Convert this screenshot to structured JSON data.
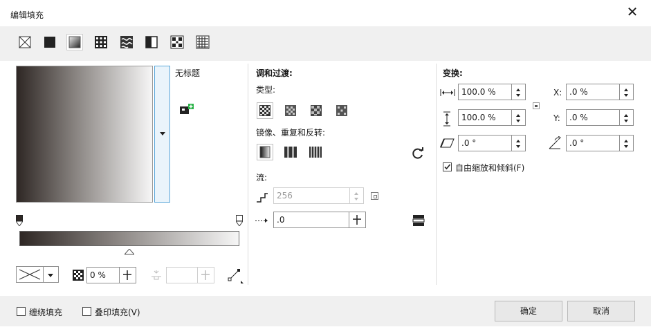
{
  "window": {
    "title": "编辑填充"
  },
  "fill_types": [
    "no-fill",
    "uniform-fill",
    "fountain-fill",
    "vector-pattern-fill",
    "bitmap-pattern-fill",
    "two-color-pattern-fill",
    "texture-fill",
    "postscript-fill"
  ],
  "preview": {
    "name": "无标题"
  },
  "blend": {
    "heading": "调和过渡:",
    "type_label": "类型:",
    "mirror_label": "镜像、重复和反转:",
    "flow_label": "流:",
    "steps_value": "256",
    "acceleration_value": ".0"
  },
  "transform": {
    "heading": "变换:",
    "width_value": "100.0 %",
    "height_value": "100.0 %",
    "x_label": "X:",
    "x_value": ".0 %",
    "y_label": "Y:",
    "y_value": ".0 %",
    "skew_value": ".0 °",
    "rotate_value": ".0 °",
    "free_scale_label": "自由缩放和倾斜(F)",
    "free_scale_checked": true
  },
  "node_bar": {
    "transparency_value": "0 %",
    "position_value": ""
  },
  "footer": {
    "wrap_fill_label": "缠绕填充",
    "overprint_fill_label": "叠印填充(V)",
    "ok_label": "确定",
    "cancel_label": "取消"
  },
  "colors": {
    "gradient_start": "#2e2724",
    "gradient_mid": "#8c8784",
    "gradient_end": "#f6f6f6",
    "focus": "#5aa6d9"
  }
}
